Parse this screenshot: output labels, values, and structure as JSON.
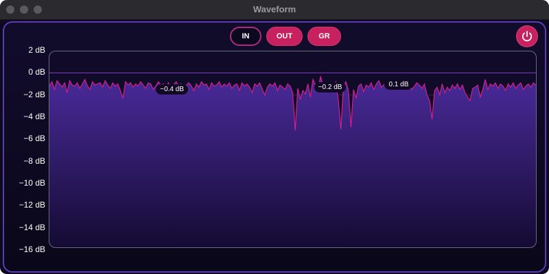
{
  "window": {
    "title": "Waveform"
  },
  "toolbar": {
    "in_label": "IN",
    "out_label": "OUT",
    "gr_label": "GR",
    "active": "IN",
    "power_icon": "power-icon"
  },
  "colors": {
    "accent": "#c7215f",
    "line": "#d61e8f",
    "fill_top": "#4a2a9a",
    "fill_bottom": "#140b33",
    "background": "#0d0a1f"
  },
  "chart_data": {
    "type": "area",
    "title": "",
    "xlabel": "",
    "ylabel": "",
    "unit": "dB",
    "ylim": [
      -16,
      2
    ],
    "yticks": [
      "2 dB",
      "0 dB",
      "−2 dB",
      "−4 dB",
      "−6 dB",
      "−8 dB",
      "−10 dB",
      "−12 dB",
      "−14 dB",
      "−16 dB"
    ],
    "reference_line": 0,
    "annotations": [
      {
        "text": "−0.4 dB",
        "x": 0.25
      },
      {
        "text": "−0.2 dB",
        "x": 0.575
      },
      {
        "text": "0.1 dB",
        "x": 0.72
      }
    ],
    "series": [
      {
        "values": [
          -1.2,
          -0.8,
          -1.5,
          -0.7,
          -1.0,
          -1.3,
          -0.9,
          -1.8,
          -0.7,
          -1.1,
          -1.2,
          -0.9,
          -1.4,
          -1.0,
          -0.6,
          -1.2,
          -1.5,
          -0.8,
          -1.1,
          -1.0,
          -0.9,
          -1.3,
          -0.7,
          -1.1,
          -1.4,
          -0.9,
          -1.2,
          -1.0,
          -1.6,
          -2.3,
          -0.8,
          -1.1,
          -0.9,
          -1.3,
          -1.0,
          -1.2,
          -0.8,
          -1.1,
          -1.4,
          -0.9,
          -1.0,
          -1.5,
          -1.2,
          -0.8,
          -1.1,
          -1.0,
          -1.3,
          -0.9,
          -1.7,
          -1.1,
          -0.8,
          -1.2,
          -1.0,
          -1.4,
          -1.1,
          -0.9,
          -1.2,
          -1.6,
          -1.0,
          -1.3,
          -0.8,
          -1.1,
          -1.0,
          -1.5,
          -0.9,
          -1.2,
          -1.1,
          -0.8,
          -1.3,
          -1.0,
          -1.2,
          -0.9,
          -1.4,
          -1.1,
          -1.0,
          -1.6,
          -0.9,
          -1.2,
          -1.0,
          -1.3,
          -1.8,
          -1.0,
          -1.2,
          -0.9,
          -1.5,
          -2.0,
          -1.3,
          -1.0,
          -1.2,
          -0.9,
          -1.6,
          -1.1,
          -1.3,
          -1.5,
          -1.0,
          -1.2,
          -1.8,
          -5.2,
          -1.4,
          -2.4,
          -1.6,
          -1.9,
          -1.0,
          -2.2,
          -0.6,
          -1.1,
          -1.6,
          -0.3,
          -1.2,
          -0.9,
          -1.4,
          -1.0,
          -1.2,
          -0.8,
          -2.5,
          -5.1,
          -1.2,
          -0.8,
          -1.6,
          -4.9,
          -1.5,
          -2.3,
          -1.2,
          -1.0,
          -1.7,
          -1.1,
          -1.3,
          -0.9,
          -1.5,
          -1.0,
          -0.7,
          -1.3,
          -1.1,
          -0.8,
          -1.2,
          -0.9,
          -1.5,
          -1.1,
          -0.9,
          -1.2,
          -1.0,
          -1.3,
          -1.0,
          -1.5,
          -1.2,
          -0.9,
          -1.1,
          -1.4,
          -1.0,
          -2.0,
          -2.5,
          -4.2,
          -1.6,
          -1.3,
          -2.0,
          -1.0,
          -1.8,
          -1.3,
          -1.6,
          -1.1,
          -1.4,
          -1.0,
          -1.5,
          -1.1,
          -1.8,
          -2.2,
          -2.5,
          -1.4,
          -1.3,
          -1.1,
          -2.2,
          -1.5,
          -0.6,
          -1.5,
          -1.0,
          -1.2,
          -0.9,
          -1.4,
          -1.0,
          -1.2,
          -1.6,
          -1.0,
          -1.3,
          -0.9,
          -1.4,
          -1.1,
          -0.9,
          -1.5,
          -1.2,
          -1.0,
          -1.3,
          -0.9,
          -1.1
        ]
      }
    ]
  }
}
